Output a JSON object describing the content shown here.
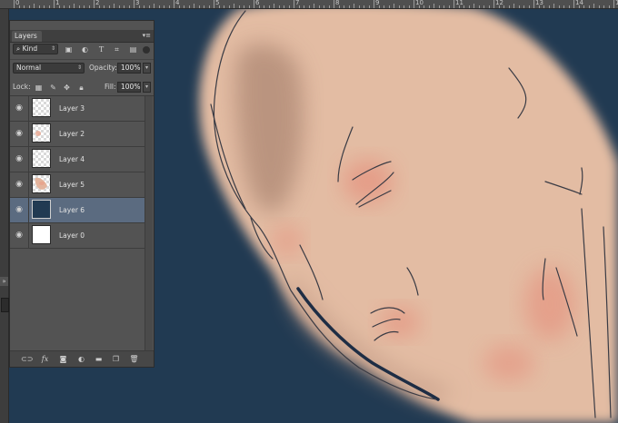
{
  "ruler": {
    "ticks": [
      "0",
      "1",
      "2",
      "3",
      "4",
      "5",
      "6",
      "7",
      "8",
      "9",
      "10",
      "11",
      "12",
      "13",
      "14",
      "15"
    ]
  },
  "panel": {
    "collapse_glyph": "«",
    "close_glyph": "x",
    "tab_label": "Layers",
    "menu_glyph": "▾≡",
    "filter_kind": "Kind",
    "blend_mode": "Normal",
    "opacity_label": "Opacity:",
    "opacity_value": "100%",
    "lock_label": "Lock:",
    "fill_label": "Fill:",
    "fill_value": "100%",
    "dropdown_glyph": "▾",
    "eye_glyph": "👁"
  },
  "layers": [
    {
      "name": "Layer 3",
      "thumb": "transparent",
      "selected": false
    },
    {
      "name": "Layer 2",
      "thumb": "transparent",
      "selected": false
    },
    {
      "name": "Layer 4",
      "thumb": "transparent",
      "selected": false
    },
    {
      "name": "Layer 5",
      "thumb": "face-sketch",
      "selected": false
    },
    {
      "name": "Layer 6",
      "thumb": "navy",
      "selected": true
    },
    {
      "name": "Layer 0",
      "thumb": "white",
      "selected": false
    }
  ],
  "icons": {
    "filter_icons": [
      "image-filter-icon",
      "adjustment-filter-icon",
      "type-filter-icon",
      "shape-filter-icon",
      "smart-object-filter-icon"
    ],
    "lock_icons": [
      "lock-transparent-pixels-icon",
      "lock-image-pixels-icon",
      "lock-position-icon",
      "lock-all-icon"
    ],
    "bottom_icons": [
      "link-layers-icon",
      "layer-style-icon",
      "add-mask-icon",
      "adjustment-layer-icon",
      "new-group-icon",
      "new-layer-icon",
      "delete-layer-icon"
    ]
  },
  "colors": {
    "canvas_bg": "#213a52",
    "skin": "#e3bca3",
    "blush": "#e59a85",
    "selection": "#5b6b80",
    "panel_bg": "#535353"
  }
}
